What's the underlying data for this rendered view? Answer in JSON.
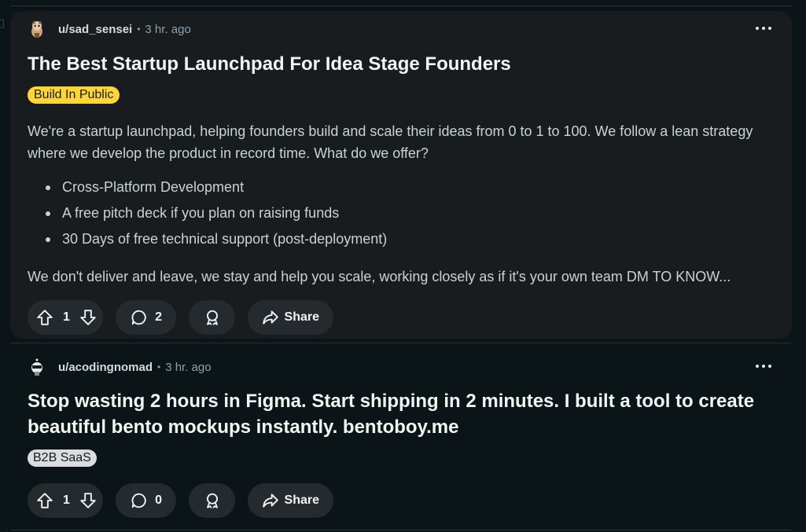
{
  "posts": [
    {
      "username": "u/sad_sensei",
      "separator": "•",
      "time": "3 hr. ago",
      "title": "The Best Startup Launchpad For Idea Stage Founders",
      "flair": "Build In Public",
      "flair_color": "#ffd635",
      "body_intro": "We're a startup launchpad, helping founders build and scale their ideas from 0 to 1 to 100. We follow a lean strategy where we develop the product in record time. What do we offer?",
      "bullets": [
        "Cross-Platform Development",
        "A free pitch deck if you plan on raising funds",
        "30 Days of free technical support (post-deployment)"
      ],
      "body_last": "We don't deliver and leave, we stay and help you scale, working closely as if it's your own team DM TO KNOW...",
      "votes": "1",
      "comments": "2",
      "share_label": "Share"
    },
    {
      "username": "u/acodingnomad",
      "separator": "•",
      "time": "3 hr. ago",
      "title": "Stop wasting 2 hours in Figma. Start shipping in 2 minutes. I built a tool to create beautiful bento mockups instantly. bentoboy.me",
      "flair": "B2B SaaS",
      "flair_color": "#dadde0",
      "votes": "1",
      "comments": "0",
      "share_label": "Share"
    }
  ],
  "icons": {
    "upvote": "upvote-arrow-icon",
    "downvote": "downvote-arrow-icon",
    "comment": "comment-bubble-icon",
    "award": "award-ribbon-icon",
    "share": "share-arrow-icon",
    "more": "more-options-icon"
  },
  "colors": {
    "background": "#0b1416",
    "card": "#181c1f",
    "pill": "#242a2e"
  }
}
